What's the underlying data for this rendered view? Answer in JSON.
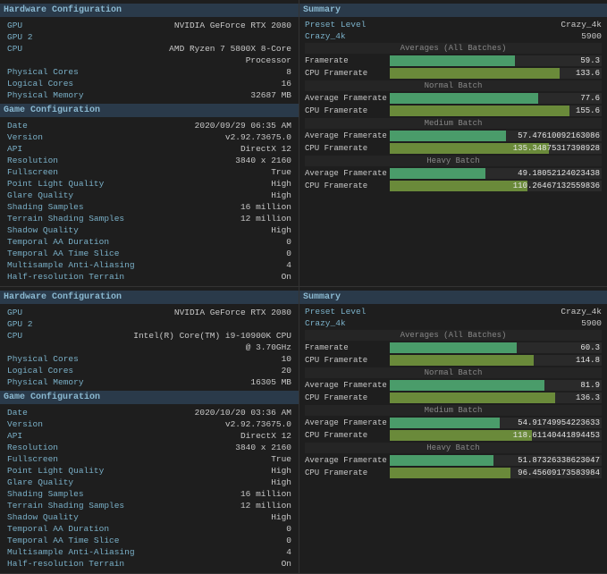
{
  "sections": [
    {
      "id": "top",
      "left": {
        "hardware_header": "Hardware Configuration",
        "hardware_rows": [
          {
            "label": "GPU",
            "value": "NVIDIA GeForce RTX 2080"
          },
          {
            "label": "GPU 2",
            "value": ""
          },
          {
            "label": "CPU",
            "value": "AMD Ryzen 7 5800X 8-Core Processor"
          },
          {
            "label": "Physical Cores",
            "value": "8"
          },
          {
            "label": "Logical Cores",
            "value": "16"
          },
          {
            "label": "Physical Memory",
            "value": "32687 MB"
          }
        ],
        "game_header": "Game Configuration",
        "game_rows": [
          {
            "label": "Date",
            "value": "2020/09/29 06:35 AM"
          },
          {
            "label": "Version",
            "value": "v2.92.73675.0"
          },
          {
            "label": "API",
            "value": "DirectX 12"
          },
          {
            "label": "Resolution",
            "value": "3840 x 2160"
          },
          {
            "label": "Fullscreen",
            "value": "True"
          },
          {
            "label": "Point Light Quality",
            "value": "High"
          },
          {
            "label": "Glare Quality",
            "value": "High"
          },
          {
            "label": "Shading Samples",
            "value": "16 million"
          },
          {
            "label": "Terrain Shading Samples",
            "value": "12 million"
          },
          {
            "label": "Shadow Quality",
            "value": "High"
          },
          {
            "label": "Temporal AA Duration",
            "value": "0"
          },
          {
            "label": "Temporal AA Time Slice",
            "value": "0"
          },
          {
            "label": "Multisample Anti-Aliasing",
            "value": "4"
          },
          {
            "label": "Half-resolution Terrain",
            "value": "On"
          }
        ]
      },
      "right": {
        "summary_header": "Summary",
        "preset_level_label": "Preset Level",
        "preset_level_value": "Crazy_4k",
        "preset_score_label": "Crazy_4k",
        "preset_score_value": "5900",
        "batches": [
          {
            "label": "Averages (All Batches)",
            "bars": [
              {
                "label": "Framerate",
                "value": "59.3",
                "pct": 59,
                "type": "framerate"
              },
              {
                "label": "CPU Framerate",
                "value": "133.6",
                "pct": 80,
                "type": "cpu"
              }
            ]
          },
          {
            "label": "Normal Batch",
            "bars": [
              {
                "label": "Average Framerate",
                "value": "77.6",
                "pct": 70,
                "type": "framerate"
              },
              {
                "label": "CPU Framerate",
                "value": "155.6",
                "pct": 85,
                "type": "cpu"
              }
            ]
          },
          {
            "label": "Medium Batch",
            "bars": [
              {
                "label": "Average Framerate",
                "value": "57.47610092163086",
                "pct": 55,
                "type": "framerate"
              },
              {
                "label": "CPU Framerate",
                "value": "135.34875317398928",
                "pct": 75,
                "type": "cpu"
              }
            ]
          },
          {
            "label": "Heavy Batch",
            "bars": [
              {
                "label": "Average Framerate",
                "value": "49.18052124023438",
                "pct": 45,
                "type": "framerate"
              },
              {
                "label": "CPU Framerate",
                "value": "110.26467132559836",
                "pct": 65,
                "type": "cpu"
              }
            ]
          }
        ]
      }
    },
    {
      "id": "bottom",
      "left": {
        "hardware_header": "Hardware Configuration",
        "hardware_rows": [
          {
            "label": "GPU",
            "value": "NVIDIA GeForce RTX 2080"
          },
          {
            "label": "GPU 2",
            "value": ""
          },
          {
            "label": "CPU",
            "value": "Intel(R) Core(TM) i9-10900K CPU @ 3.70GHz"
          },
          {
            "label": "Physical Cores",
            "value": "10"
          },
          {
            "label": "Logical Cores",
            "value": "20"
          },
          {
            "label": "Physical Memory",
            "value": "16305 MB"
          }
        ],
        "game_header": "Game Configuration",
        "game_rows": [
          {
            "label": "Date",
            "value": "2020/10/20 03:36 AM"
          },
          {
            "label": "Version",
            "value": "v2.92.73675.0"
          },
          {
            "label": "API",
            "value": "DirectX 12"
          },
          {
            "label": "Resolution",
            "value": "3840 x 2160"
          },
          {
            "label": "Fullscreen",
            "value": "True"
          },
          {
            "label": "Point Light Quality",
            "value": "High"
          },
          {
            "label": "Glare Quality",
            "value": "High"
          },
          {
            "label": "Shading Samples",
            "value": "16 million"
          },
          {
            "label": "Terrain Shading Samples",
            "value": "12 million"
          },
          {
            "label": "Shadow Quality",
            "value": "High"
          },
          {
            "label": "Temporal AA Duration",
            "value": "0"
          },
          {
            "label": "Temporal AA Time Slice",
            "value": "0"
          },
          {
            "label": "Multisample Anti-Aliasing",
            "value": "4"
          },
          {
            "label": "Half-resolution Terrain",
            "value": "On"
          }
        ]
      },
      "right": {
        "summary_header": "Summary",
        "preset_level_label": "Preset Level",
        "preset_level_value": "Crazy_4k",
        "preset_score_label": "Crazy_4k",
        "preset_score_value": "5900",
        "batches": [
          {
            "label": "Averages (All Batches)",
            "bars": [
              {
                "label": "Framerate",
                "value": "60.3",
                "pct": 60,
                "type": "framerate"
              },
              {
                "label": "CPU Framerate",
                "value": "114.8",
                "pct": 68,
                "type": "cpu"
              }
            ]
          },
          {
            "label": "Normal Batch",
            "bars": [
              {
                "label": "Average Framerate",
                "value": "81.9",
                "pct": 73,
                "type": "framerate"
              },
              {
                "label": "CPU Framerate",
                "value": "136.3",
                "pct": 78,
                "type": "cpu"
              }
            ]
          },
          {
            "label": "Medium Batch",
            "bars": [
              {
                "label": "Average Framerate",
                "value": "54.91749954223633",
                "pct": 52,
                "type": "framerate"
              },
              {
                "label": "CPU Framerate",
                "value": "118.61140441894453",
                "pct": 67,
                "type": "cpu"
              }
            ]
          },
          {
            "label": "Heavy Batch",
            "bars": [
              {
                "label": "Average Framerate",
                "value": "51.87326338623047",
                "pct": 49,
                "type": "framerate"
              },
              {
                "label": "CPU Framerate",
                "value": "96.45609173583984",
                "pct": 57,
                "type": "cpu"
              }
            ]
          }
        ]
      }
    }
  ]
}
